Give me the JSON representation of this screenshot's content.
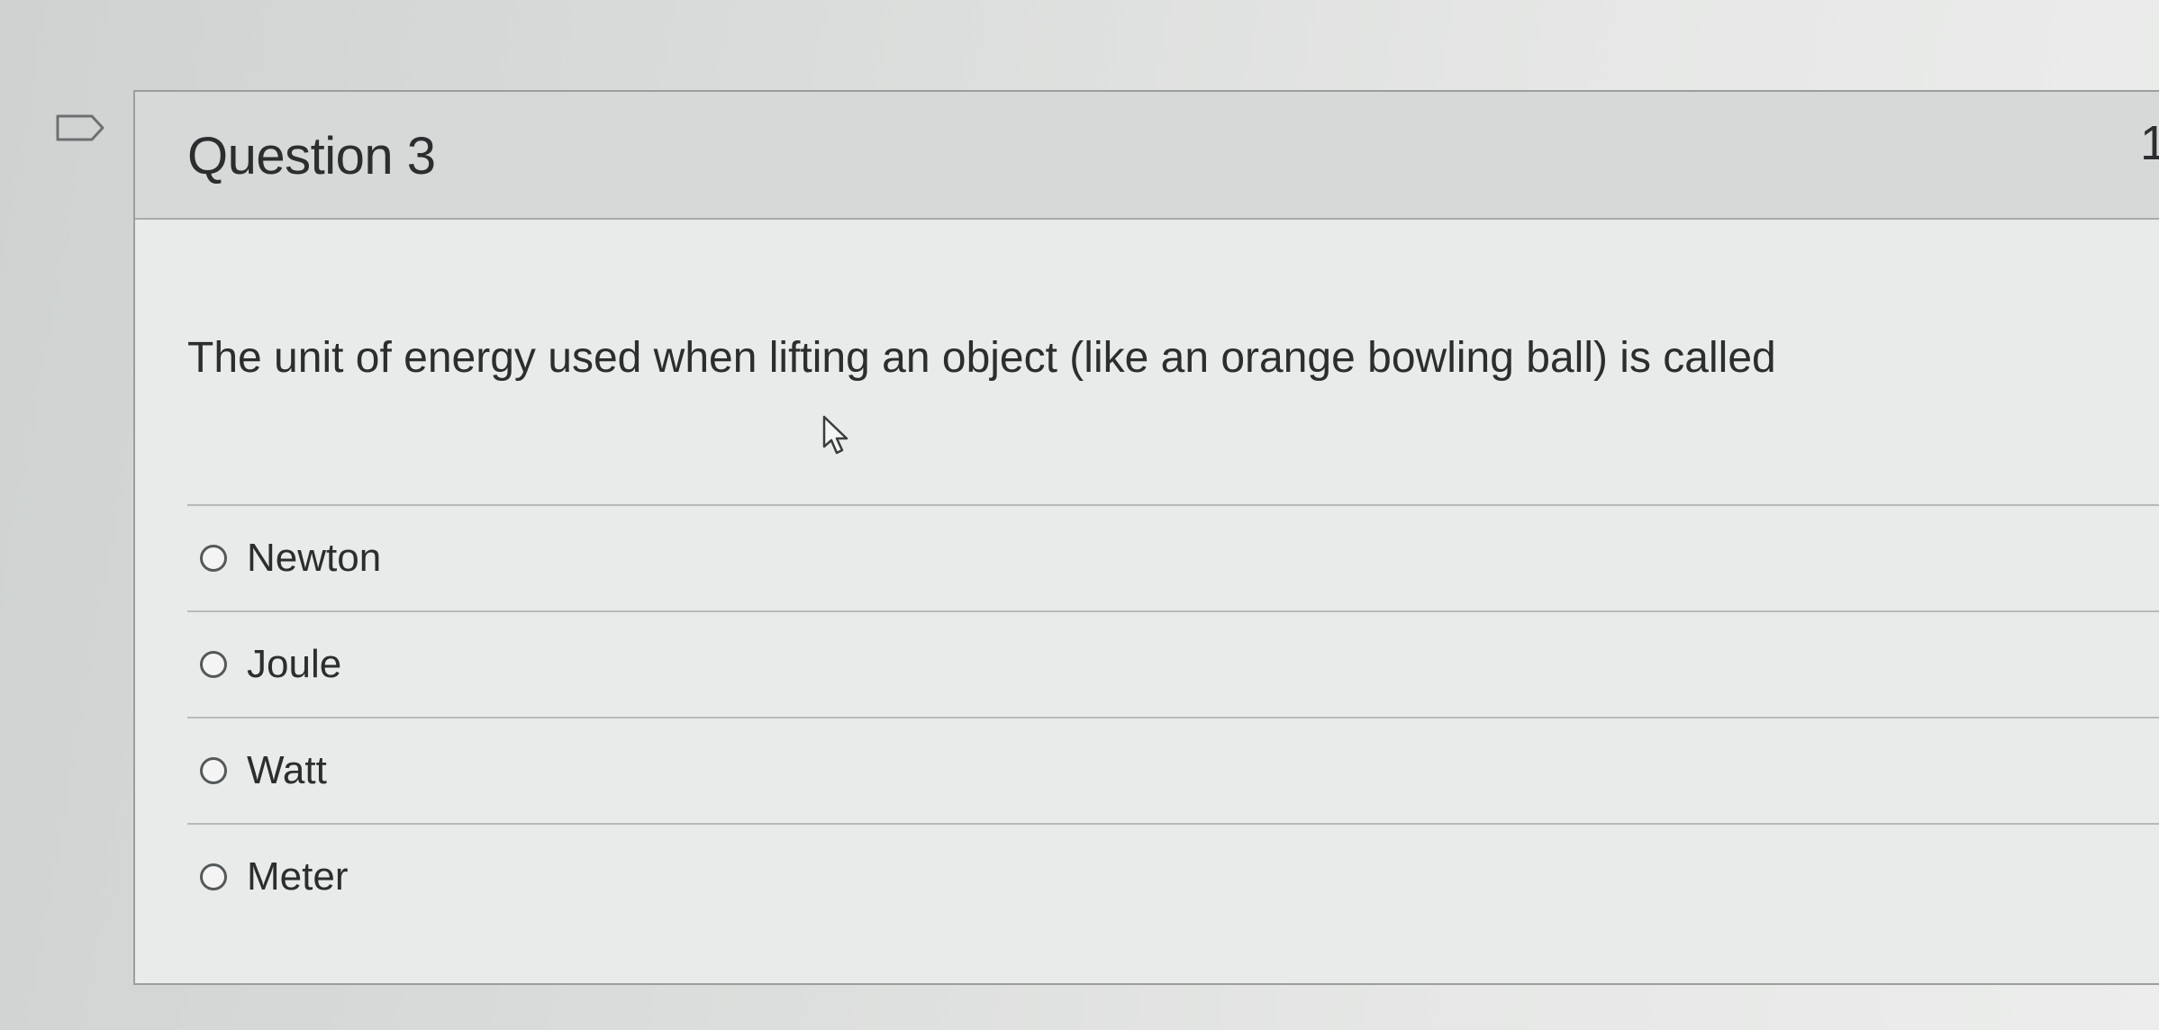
{
  "question": {
    "title": "Question 3",
    "points": "1",
    "text": "The unit of energy used when lifting an object (like an orange bowling ball) is called"
  },
  "answers": [
    {
      "label": "Newton",
      "selected": false
    },
    {
      "label": "Joule",
      "selected": false
    },
    {
      "label": "Watt",
      "selected": false
    },
    {
      "label": "Meter",
      "selected": false
    }
  ],
  "icons": {
    "flag": "flag-outline-icon",
    "cursor": "mouse-pointer-icon"
  }
}
